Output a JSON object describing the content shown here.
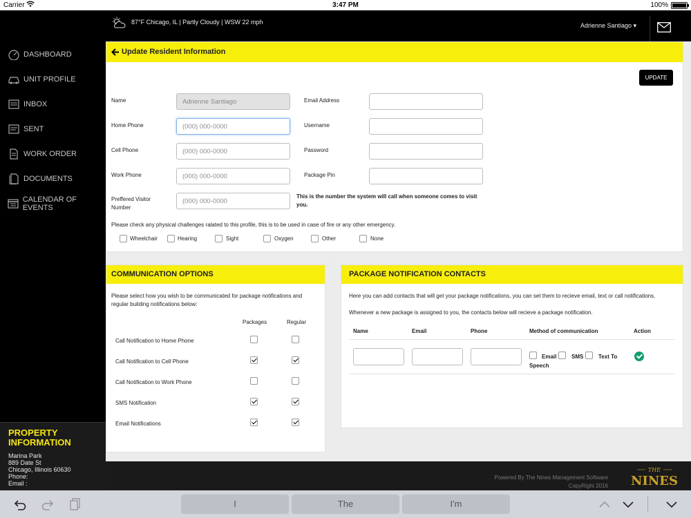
{
  "status_bar": {
    "carrier": "Carrier",
    "time": "3:47 PM",
    "battery": "100%"
  },
  "sidebar": {
    "items": [
      {
        "label": "DASHBOARD",
        "icon": "dashboard-icon"
      },
      {
        "label": "UNIT PROFILE",
        "icon": "car-icon"
      },
      {
        "label": "INBOX",
        "icon": "inbox-icon"
      },
      {
        "label": "SENT",
        "icon": "sent-icon"
      },
      {
        "label": "WORK ORDER",
        "icon": "document-icon"
      },
      {
        "label": "DOCUMENTS",
        "icon": "documents-icon"
      },
      {
        "label": "CALENDAR OF EVENTS",
        "icon": "calendar-icon"
      }
    ],
    "property": {
      "title": "PROPERTY INFORMATION",
      "name": "Marina Park",
      "street": "889 Date St",
      "city": "Chicago, Illinois 60630",
      "phone": "Phone:",
      "email": "Email :"
    }
  },
  "topbar": {
    "weather": "87°F Chicago, IL | Partly Cloudy | WSW 22 mph",
    "user": "Adrienne Santiago ▾"
  },
  "update_panel": {
    "title": "Update Resident Information",
    "update_button": "UPDATE",
    "fields": {
      "name_label": "Name",
      "name_value": "Adrienne Santiago",
      "home_phone_label": "Home Phone",
      "cell_phone_label": "Cell Phone",
      "work_phone_label": "Work Phone",
      "visitor_label": "Preffered Visitor Number",
      "phone_placeholder": "(000) 000-0000",
      "email_label": "Email Address",
      "username_label": "Username",
      "password_label": "Password",
      "package_pin_label": "Package Pin"
    },
    "visitor_note": "This is the number the system will call when someone comes to visit you.",
    "challenges_text": "Please check any physical challenges ralated to this profile, this is to be used in case of fire or any other emergency.",
    "challenges": [
      "Wheelchair",
      "Hearing",
      "Sight",
      "Oxygen",
      "Other",
      "None"
    ]
  },
  "communication": {
    "title": "COMMUNICATION OPTIONS",
    "description": "Please select how you wish to be communicated for package notifications and regular building notifications below:",
    "col_packages": "Packages",
    "col_regular": "Regular",
    "rows": [
      {
        "label": "Call Notification to Home Phone",
        "packages": false,
        "regular": false
      },
      {
        "label": "Call Notification to Cell Phone",
        "packages": true,
        "regular": true
      },
      {
        "label": "Call Notification to Work Phone",
        "packages": false,
        "regular": false
      },
      {
        "label": "SMS Notification",
        "packages": true,
        "regular": true
      },
      {
        "label": "Email Notifications",
        "packages": true,
        "regular": true
      }
    ]
  },
  "package_contacts": {
    "title": "PACKAGE NOTIFICATION CONTACTS",
    "description": "Here you can add contacts that will get your package notifications, you can set them to recieve email, text or call notifications.",
    "description2": "Whenever a new package is assigned to you, the contacts below will recieve a package notification.",
    "columns": {
      "name": "Name",
      "email": "Email",
      "phone": "Phone",
      "method": "Method of communication",
      "action": "Action"
    },
    "methods": {
      "email": "Email",
      "sms": "SMS",
      "tts_a": "Text To",
      "tts_b": "Speech"
    }
  },
  "footer": {
    "powered": "Powered By The Nines Management Software",
    "copyright": "CopyRight 2016",
    "logo_top": "THE",
    "logo_main": "NINES"
  },
  "keyboard": {
    "suggestions": [
      "I",
      "The",
      "I'm"
    ]
  },
  "colors": {
    "accent": "#f7ee0c",
    "sidebar_bg": "#000000",
    "action_green": "#129c6c"
  }
}
